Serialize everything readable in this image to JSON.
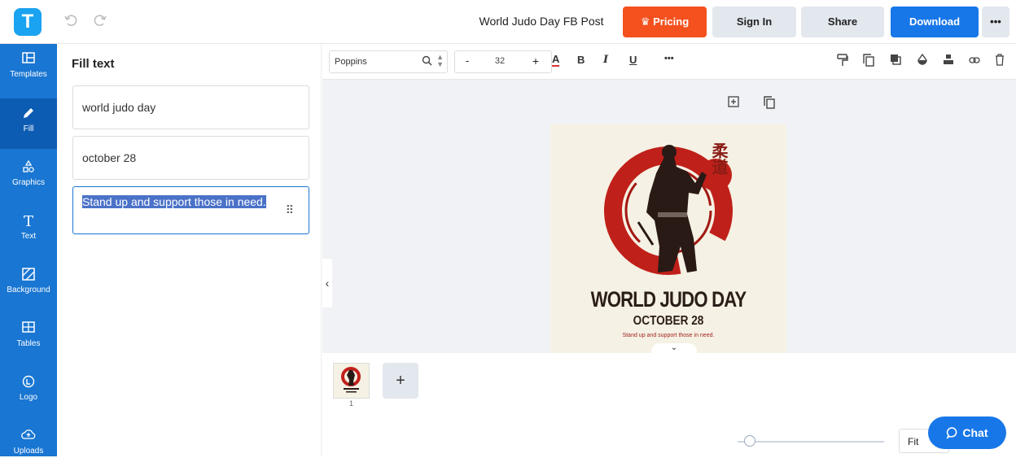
{
  "header": {
    "logo_letter": "T",
    "doc_title": "World Judo Day FB Post",
    "pricing_label": "Pricing",
    "signin_label": "Sign In",
    "share_label": "Share",
    "download_label": "Download",
    "more_label": "•••"
  },
  "sidebar": {
    "items": [
      {
        "label": "Templates",
        "icon": "templates-icon"
      },
      {
        "label": "Fill",
        "icon": "pencil-icon"
      },
      {
        "label": "Graphics",
        "icon": "shapes-icon"
      },
      {
        "label": "Text",
        "icon": "text-icon"
      },
      {
        "label": "Background",
        "icon": "background-icon"
      },
      {
        "label": "Tables",
        "icon": "table-icon"
      },
      {
        "label": "Logo",
        "icon": "logo-icon"
      },
      {
        "label": "Uploads",
        "icon": "cloud-upload-icon"
      }
    ]
  },
  "panel": {
    "title": "Fill text",
    "fields": [
      "world judo day",
      "october 28",
      "Stand up and support those in need."
    ]
  },
  "toolbar": {
    "font": "Poppins",
    "size": "32",
    "size_minus": "-",
    "size_plus": "+",
    "color_label": "A",
    "bold_label": "B",
    "italic_label": "I",
    "underline_label": "U",
    "more_label": "•••"
  },
  "poster": {
    "title": "WORLD JUDO DAY",
    "date": "OCTOBER 28",
    "subtitle": "Stand up and support those in need.",
    "kanji": "柔道"
  },
  "pages": {
    "page_number": "1",
    "add_label": "+"
  },
  "zoom": {
    "fit_label": "Fit"
  },
  "chat": {
    "label": "Chat"
  },
  "colors": {
    "sidebar": "#1976d2",
    "pricing": "#f4511e",
    "download": "#1877e8",
    "poster_bg": "#f5f1e4",
    "poster_red": "#c0201a"
  }
}
